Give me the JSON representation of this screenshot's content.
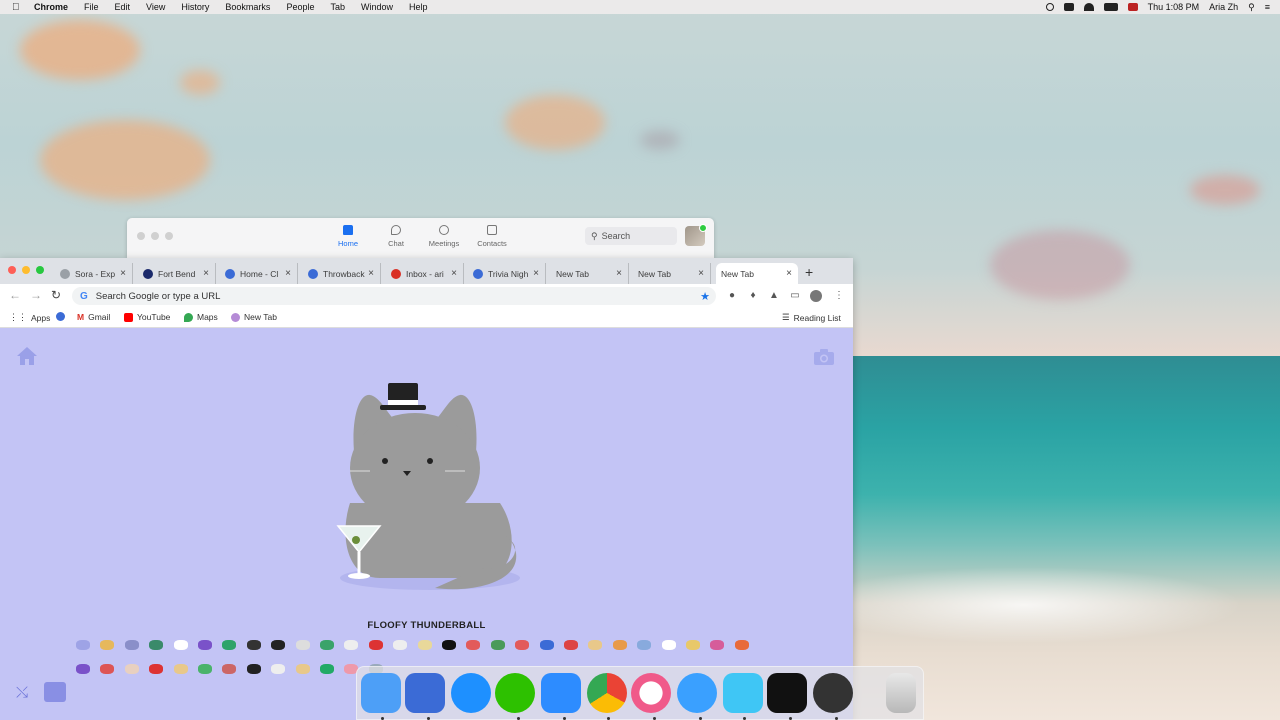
{
  "menubar": {
    "app": "Chrome",
    "items": [
      "File",
      "Edit",
      "View",
      "History",
      "Bookmarks",
      "People",
      "Tab",
      "Window",
      "Help"
    ],
    "clock": "Thu 1:08 PM",
    "user": "Aria Zh"
  },
  "zoom": {
    "nav": [
      {
        "label": "Home",
        "icon": "home-icon",
        "active": true
      },
      {
        "label": "Chat",
        "icon": "chat-icon"
      },
      {
        "label": "Meetings",
        "icon": "clock-icon"
      },
      {
        "label": "Contacts",
        "icon": "contacts-icon"
      }
    ],
    "search_placeholder": "Search"
  },
  "chrome": {
    "tabs": [
      {
        "label": "Sora - Exp",
        "color": "#9aa0a6"
      },
      {
        "label": "Fort Bend",
        "color": "#1b2a6b"
      },
      {
        "label": "Home - Cl",
        "color": "#3b6bd6"
      },
      {
        "label": "Throwback",
        "color": "#3b6bd6"
      },
      {
        "label": "Inbox - ari",
        "color": "#d93025"
      },
      {
        "label": "Trivia Nigh",
        "color": "#3b6bd6"
      },
      {
        "label": "New Tab",
        "color": ""
      },
      {
        "label": "New Tab",
        "color": ""
      },
      {
        "label": "New Tab",
        "color": "",
        "active": true
      }
    ],
    "omnibox_placeholder": "Search Google or type a URL",
    "bookmarks": [
      {
        "label": "Apps",
        "color": "#5f6368"
      },
      {
        "label": "",
        "color": "#3b6bd6"
      },
      {
        "label": "Gmail",
        "color": "#d93025"
      },
      {
        "label": "YouTube",
        "color": "#ff0000"
      },
      {
        "label": "Maps",
        "color": "#34a853"
      },
      {
        "label": "New Tab",
        "color": "#b58bd6"
      }
    ],
    "reading_list": "Reading List"
  },
  "page": {
    "background": "#c3c4f5",
    "cat_name": "FLOOFY THUNDERBALL",
    "cat_color": "#9b9b9b"
  },
  "dock": {
    "apps": [
      "Finder",
      "Monday",
      "App Store",
      "WeChat",
      "Zoom",
      "Chrome",
      "iTunes",
      "Messages",
      "TestFlight",
      "Kindle",
      "QuickTime",
      "Trash"
    ]
  }
}
